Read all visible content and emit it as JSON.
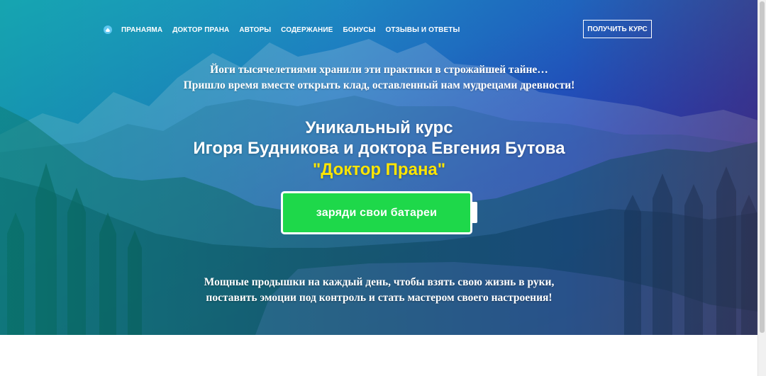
{
  "nav": {
    "logo_icon": "home-cloud-icon",
    "items": [
      "ПРАНАЯМА",
      "ДОКТОР ПРАНА",
      "АВТОРЫ",
      "СОДЕРЖАНИЕ",
      "БОНУСЫ",
      "ОТЗЫВЫ И ОТВЕТЫ"
    ],
    "cta_label": "ПОЛУЧИТЬ КУРС"
  },
  "hero": {
    "intro_lines": [
      "Йоги тысячелетиями хранили эти практики в строжайшей тайне…",
      "Пришло время вместе открыть клад, оставленный нам мудрецами древности!"
    ],
    "headline_lines": [
      "Уникальный курс",
      "Игоря Будникова и доктора Евгения Бутова",
      "\"Доктор Прана\""
    ],
    "battery_button_label": "заряди свои батареи",
    "bottom_lines": [
      "Мощные продышки на каждый день, чтобы взять свою жизнь в руки,",
      "поставить эмоции под контроль и стать мастером своего настроения!"
    ]
  },
  "colors": {
    "accent_yellow": "#ffe600",
    "battery_green": "#1ed84a",
    "text": "#ffffff"
  }
}
